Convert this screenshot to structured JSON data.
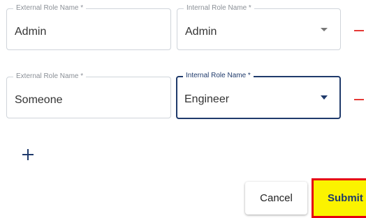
{
  "mappings": [
    {
      "external_label": "External Role Name *",
      "external_value": "Admin",
      "internal_label": "Internal Role Name *",
      "internal_value": "Admin"
    },
    {
      "external_label": "External Role Name *",
      "external_value": "Someone",
      "internal_label": "Internal Role Name *",
      "internal_value": "Engineer"
    }
  ],
  "buttons": {
    "cancel_label": "Cancel",
    "submit_label": "Submit"
  },
  "icons": {
    "dropdown": "chevron-down-icon",
    "remove": "minus-icon",
    "add": "plus-icon"
  },
  "colors": {
    "accent": "#1f3a6b",
    "remove": "#e53935",
    "submit_bg": "#fbf300",
    "submit_border": "#e60012"
  }
}
